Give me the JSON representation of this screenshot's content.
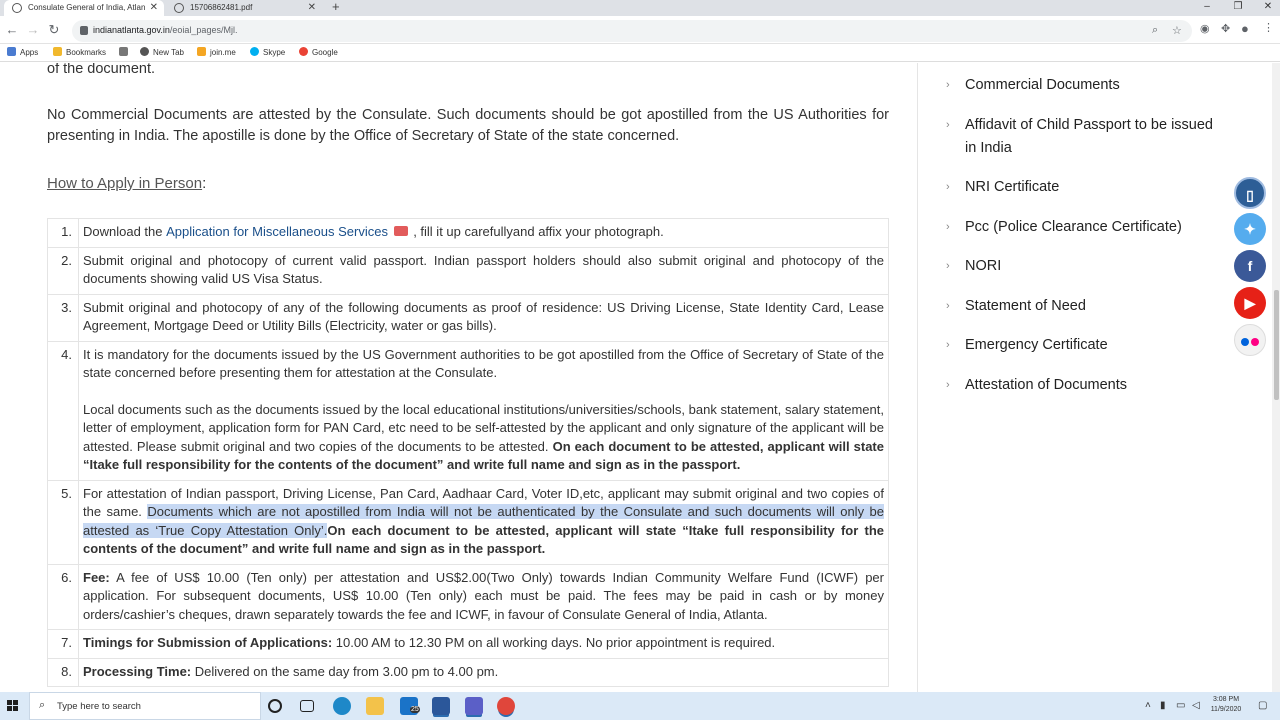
{
  "browser": {
    "tabs": [
      {
        "title": "Consulate General of India, Atlan",
        "active": true
      },
      {
        "title": "15706862481.pdf",
        "active": false
      }
    ],
    "url_host": "indianatlanta.gov.in",
    "url_path": "/eoial_pages/Mjl.",
    "bookmarks": [
      "Apps",
      "Bookmarks",
      "",
      "New Tab",
      "join.me",
      "Skype",
      "Google"
    ]
  },
  "content": {
    "lead_line": "of the document.",
    "paragraph": "No Commercial Documents are attested by the Consulate.  Such documents should be got apostilled from the US Authorities for presenting in India.  The apostille is done by the Office of Secretary of State of the state concerned.",
    "howto_label": "How to Apply in Person",
    "howto_colon": ":",
    "steps": {
      "s1": {
        "num": "1.",
        "pre": "Download the ",
        "link": "Application for Miscellaneous Services",
        "post": " , fill it up carefullyand affix your photograph."
      },
      "s2": {
        "num": "2.",
        "text": "Submit original and photocopy of current valid passport.  Indian passport holders should also submit original and photocopy of the documents showing valid US Visa Status."
      },
      "s3": {
        "num": "3.",
        "text": "Submit original and photocopy of any of the following documents as proof of residence: US Driving License, State Identity Card, Lease Agreement, Mortgage Deed or Utility Bills (Electricity, water or gas bills)."
      },
      "s4": {
        "num": "4.",
        "text_a": "It is mandatory for the documents issued by the US Government authorities to be got apostilled from the Office of Secretary of State of the state concerned before presenting them for attestation at the Consulate.",
        "text_b": "Local documents such as the documents issued by the local educational institutions/universities/schools, bank statement, salary statement, letter of employment, application form for PAN Card, etc need to be self-attested by the applicant and only signature of the applicant will be attested.  Please submit original and two copies of the documents to be attested.  ",
        "text_b_bold": "On each document to be attested, applicant will state “Itake full responsibility for the contents of the document” and write full name and sign as in the passport."
      },
      "s5": {
        "num": "5.",
        "pre": "For attestation of Indian passport, Driving License, Pan Card, Aadhaar Card, Voter ID,etc, applicant may submit original and two copies of the same. ",
        "selected": "Documents which are not apostilled from India will not be authenticated by the Consulate and such documents will only be attested as ‘True Copy Attestation Only’.",
        "bold": "On each document to be attested, applicant will state “Itake full responsibility for the contents of the document” and write full name and sign as in the passport."
      },
      "s6": {
        "num": "6.",
        "label": "Fee:",
        "text": "  A fee of US$ 10.00 (Ten only) per attestation and US$2.00(Two Only) towards Indian Community Welfare Fund (ICWF) per application. For subsequent documents, US$ 10.00 (Ten only) each must be paid. The fees may be paid in cash or by money orders/cashier’s cheques, drawn separately towards the fee and ICWF, in favour of Consulate General of India, Atlanta."
      },
      "s7": {
        "num": "7.",
        "label": "Timings for Submission of Applications:",
        "text": " 10.00 AM to 12.30 PM on all working days.  No prior appointment is required."
      },
      "s8": {
        "num": "8.",
        "label": "Processing Time:",
        "text": " Delivered on the same day from 3.00 pm to 4.00 pm."
      }
    }
  },
  "sidebar": {
    "items": [
      "Commercial Documents",
      "Affidavit of Child Passport to be issued in India",
      "NRI Certificate",
      "Pcc (Police Clearance Certificate)",
      "NORI",
      "Statement of Need",
      "Emergency Certificate",
      "Attestation of Documents"
    ]
  },
  "social_icons": [
    "mobile-icon",
    "twitter-icon",
    "facebook-icon",
    "youtube-icon",
    "flickr-icon"
  ],
  "taskbar": {
    "search_placeholder": "Type here to search",
    "mail_badge": "25",
    "time": "3:08 PM",
    "date": "11/9/2020"
  },
  "colors": {
    "link": "#1a4f8a",
    "selection": "#c6d8f3",
    "twitter": "#55acee",
    "facebook": "#3b5998",
    "youtube": "#e62117"
  }
}
